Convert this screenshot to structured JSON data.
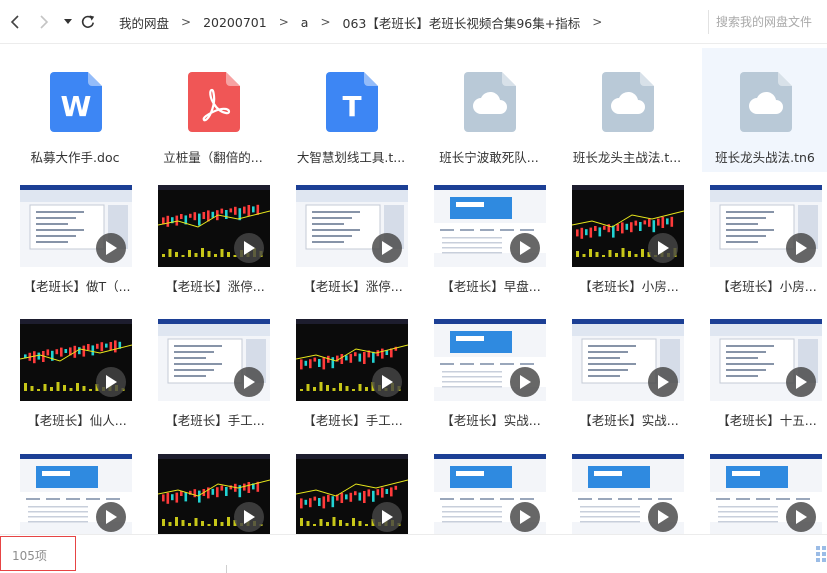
{
  "toolbar": {
    "breadcrumbs": [
      "我的网盘",
      "20200701",
      "a",
      "063【老班长】老班长视频合集96集+指标"
    ],
    "breadcrumb_separator": ">",
    "search_placeholder": "搜索我的网盘文件"
  },
  "files": [
    {
      "name": "私募大作手.doc",
      "type": "word",
      "glyph": "W",
      "color": "#3d86f4"
    },
    {
      "name": "立桩量（翻倍的...",
      "type": "pdf",
      "glyph": "pdf-icon",
      "color": "#f05656"
    },
    {
      "name": "大智慧划线工具.t...",
      "type": "text",
      "glyph": "T",
      "color": "#3d86f4"
    },
    {
      "name": "班长宁波敢死队...",
      "type": "unknown",
      "glyph": "cloud-icon",
      "color": "#b9c9d7"
    },
    {
      "name": "班长龙头主战法.t...",
      "type": "unknown",
      "glyph": "cloud-icon",
      "color": "#b9c9d7"
    },
    {
      "name": "班长龙头战法.tn6",
      "type": "unknown",
      "glyph": "cloud-icon",
      "color": "#b9c9d7",
      "selected": true
    }
  ],
  "videos": [
    {
      "name": "【老班长】做T（..."
    },
    {
      "name": "【老班长】涨停..."
    },
    {
      "name": "【老班长】涨停..."
    },
    {
      "name": "【老班长】早盘..."
    },
    {
      "name": "【老班长】小房..."
    },
    {
      "name": "【老班长】小房..."
    },
    {
      "name": "【老班长】仙人..."
    },
    {
      "name": "【老班长】手工..."
    },
    {
      "name": "【老班长】手工..."
    },
    {
      "name": "【老班长】实战..."
    },
    {
      "name": "【老班长】实战..."
    },
    {
      "name": "【老班长】十五..."
    },
    {
      "name": ""
    },
    {
      "name": ""
    },
    {
      "name": ""
    },
    {
      "name": ""
    },
    {
      "name": ""
    },
    {
      "name": ""
    }
  ],
  "status": {
    "item_count": "105项"
  }
}
